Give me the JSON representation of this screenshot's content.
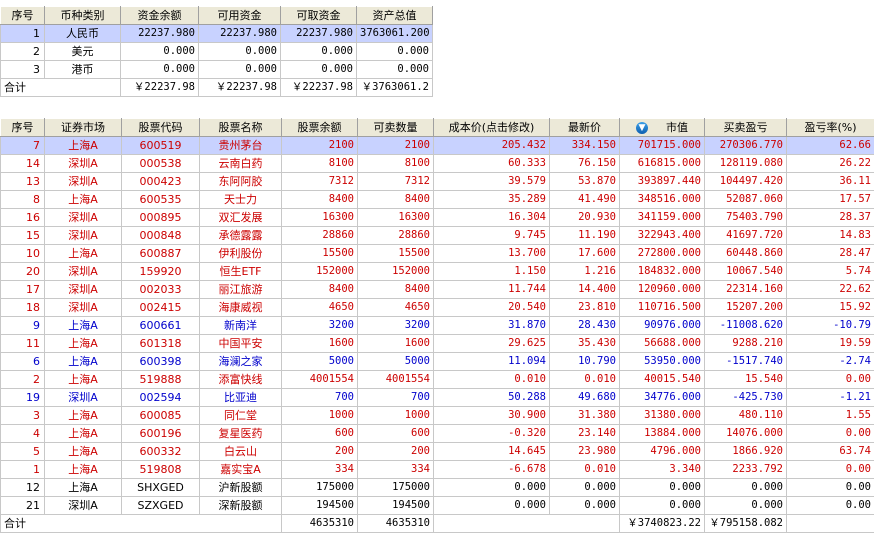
{
  "summary": {
    "headers": [
      "序号",
      "币种类别",
      "资金余额",
      "可用资金",
      "可取资金",
      "资产总值"
    ],
    "rows": [
      {
        "idx": "1",
        "currency": "人民币",
        "balance": "22237.980",
        "available": "22237.980",
        "withdrawable": "22237.980",
        "total": "3763061.200"
      },
      {
        "idx": "2",
        "currency": "美元",
        "balance": "0.000",
        "available": "0.000",
        "withdrawable": "0.000",
        "total": "0.000"
      },
      {
        "idx": "3",
        "currency": "港币",
        "balance": "0.000",
        "available": "0.000",
        "withdrawable": "0.000",
        "total": "0.000"
      }
    ],
    "total": {
      "label": "合计",
      "balance": "￥22237.98",
      "available": "￥22237.98",
      "withdrawable": "￥22237.98",
      "total": "￥3763061.2"
    }
  },
  "holdings": {
    "headers": [
      "序号",
      "证券市场",
      "股票代码",
      "股票名称",
      "股票余额",
      "可卖数量",
      "成本价(点击修改)",
      "最新价",
      "市值",
      "买卖盈亏",
      "盈亏率(%)"
    ],
    "sort_icon": "sort-descending-icon",
    "colors": {
      "up": "#cc0000",
      "down": "#0000cc",
      "selected": "#c8d2ff"
    },
    "rows": [
      {
        "idx": "7",
        "market": "上海A",
        "code": "600519",
        "name": "贵州茅台",
        "qty": "2100",
        "sellable": "2100",
        "cost": "205.432",
        "price": "334.150",
        "value": "701715.000",
        "pnl": "270306.770",
        "rate": "62.66",
        "color": "red"
      },
      {
        "idx": "14",
        "market": "深圳A",
        "code": "000538",
        "name": "云南白药",
        "qty": "8100",
        "sellable": "8100",
        "cost": "60.333",
        "price": "76.150",
        "value": "616815.000",
        "pnl": "128119.080",
        "rate": "26.22",
        "color": "red"
      },
      {
        "idx": "13",
        "market": "深圳A",
        "code": "000423",
        "name": "东阿阿胶",
        "qty": "7312",
        "sellable": "7312",
        "cost": "39.579",
        "price": "53.870",
        "value": "393897.440",
        "pnl": "104497.420",
        "rate": "36.11",
        "color": "red"
      },
      {
        "idx": "8",
        "market": "上海A",
        "code": "600535",
        "name": "天士力",
        "qty": "8400",
        "sellable": "8400",
        "cost": "35.289",
        "price": "41.490",
        "value": "348516.000",
        "pnl": "52087.060",
        "rate": "17.57",
        "color": "red"
      },
      {
        "idx": "16",
        "market": "深圳A",
        "code": "000895",
        "name": "双汇发展",
        "qty": "16300",
        "sellable": "16300",
        "cost": "16.304",
        "price": "20.930",
        "value": "341159.000",
        "pnl": "75403.790",
        "rate": "28.37",
        "color": "red"
      },
      {
        "idx": "15",
        "market": "深圳A",
        "code": "000848",
        "name": "承德露露",
        "qty": "28860",
        "sellable": "28860",
        "cost": "9.745",
        "price": "11.190",
        "value": "322943.400",
        "pnl": "41697.720",
        "rate": "14.83",
        "color": "red"
      },
      {
        "idx": "10",
        "market": "上海A",
        "code": "600887",
        "name": "伊利股份",
        "qty": "15500",
        "sellable": "15500",
        "cost": "13.700",
        "price": "17.600",
        "value": "272800.000",
        "pnl": "60448.860",
        "rate": "28.47",
        "color": "red"
      },
      {
        "idx": "20",
        "market": "深圳A",
        "code": "159920",
        "name": "恒生ETF",
        "qty": "152000",
        "sellable": "152000",
        "cost": "1.150",
        "price": "1.216",
        "value": "184832.000",
        "pnl": "10067.540",
        "rate": "5.74",
        "color": "red"
      },
      {
        "idx": "17",
        "market": "深圳A",
        "code": "002033",
        "name": "丽江旅游",
        "qty": "8400",
        "sellable": "8400",
        "cost": "11.744",
        "price": "14.400",
        "value": "120960.000",
        "pnl": "22314.160",
        "rate": "22.62",
        "color": "red"
      },
      {
        "idx": "18",
        "market": "深圳A",
        "code": "002415",
        "name": "海康威视",
        "qty": "4650",
        "sellable": "4650",
        "cost": "20.540",
        "price": "23.810",
        "value": "110716.500",
        "pnl": "15207.200",
        "rate": "15.92",
        "color": "red"
      },
      {
        "idx": "9",
        "market": "上海A",
        "code": "600661",
        "name": "新南洋",
        "qty": "3200",
        "sellable": "3200",
        "cost": "31.870",
        "price": "28.430",
        "value": "90976.000",
        "pnl": "-11008.620",
        "rate": "-10.79",
        "color": "blue"
      },
      {
        "idx": "11",
        "market": "上海A",
        "code": "601318",
        "name": "中国平安",
        "qty": "1600",
        "sellable": "1600",
        "cost": "29.625",
        "price": "35.430",
        "value": "56688.000",
        "pnl": "9288.210",
        "rate": "19.59",
        "color": "red"
      },
      {
        "idx": "6",
        "market": "上海A",
        "code": "600398",
        "name": "海澜之家",
        "qty": "5000",
        "sellable": "5000",
        "cost": "11.094",
        "price": "10.790",
        "value": "53950.000",
        "pnl": "-1517.740",
        "rate": "-2.74",
        "color": "blue"
      },
      {
        "idx": "2",
        "market": "上海A",
        "code": "519888",
        "name": "添富快线",
        "qty": "4001554",
        "sellable": "4001554",
        "cost": "0.010",
        "price": "0.010",
        "value": "40015.540",
        "pnl": "15.540",
        "rate": "0.00",
        "color": "red"
      },
      {
        "idx": "19",
        "market": "深圳A",
        "code": "002594",
        "name": "比亚迪",
        "qty": "700",
        "sellable": "700",
        "cost": "50.288",
        "price": "49.680",
        "value": "34776.000",
        "pnl": "-425.730",
        "rate": "-1.21",
        "color": "blue"
      },
      {
        "idx": "3",
        "market": "上海A",
        "code": "600085",
        "name": "同仁堂",
        "qty": "1000",
        "sellable": "1000",
        "cost": "30.900",
        "price": "31.380",
        "value": "31380.000",
        "pnl": "480.110",
        "rate": "1.55",
        "color": "red"
      },
      {
        "idx": "4",
        "market": "上海A",
        "code": "600196",
        "name": "复星医药",
        "qty": "600",
        "sellable": "600",
        "cost": "-0.320",
        "price": "23.140",
        "value": "13884.000",
        "pnl": "14076.000",
        "rate": "0.00",
        "color": "red"
      },
      {
        "idx": "5",
        "market": "上海A",
        "code": "600332",
        "name": "白云山",
        "qty": "200",
        "sellable": "200",
        "cost": "14.645",
        "price": "23.980",
        "value": "4796.000",
        "pnl": "1866.920",
        "rate": "63.74",
        "color": "red"
      },
      {
        "idx": "1",
        "market": "上海A",
        "code": "519808",
        "name": "嘉实宝A",
        "qty": "334",
        "sellable": "334",
        "cost": "-6.678",
        "price": "0.010",
        "value": "3.340",
        "pnl": "2233.792",
        "rate": "0.00",
        "color": "red"
      },
      {
        "idx": "12",
        "market": "上海A",
        "code": "SHXGED",
        "name": "沪新股额",
        "qty": "175000",
        "sellable": "175000",
        "cost": "0.000",
        "price": "0.000",
        "value": "0.000",
        "pnl": "0.000",
        "rate": "0.00",
        "color": "black"
      },
      {
        "idx": "21",
        "market": "深圳A",
        "code": "SZXGED",
        "name": "深新股额",
        "qty": "194500",
        "sellable": "194500",
        "cost": "0.000",
        "price": "0.000",
        "value": "0.000",
        "pnl": "0.000",
        "rate": "0.00",
        "color": "black"
      }
    ],
    "total": {
      "label": "合计",
      "qty": "4635310",
      "sellable": "4635310",
      "value": "￥3740823.22",
      "pnl": "￥795158.082"
    }
  }
}
